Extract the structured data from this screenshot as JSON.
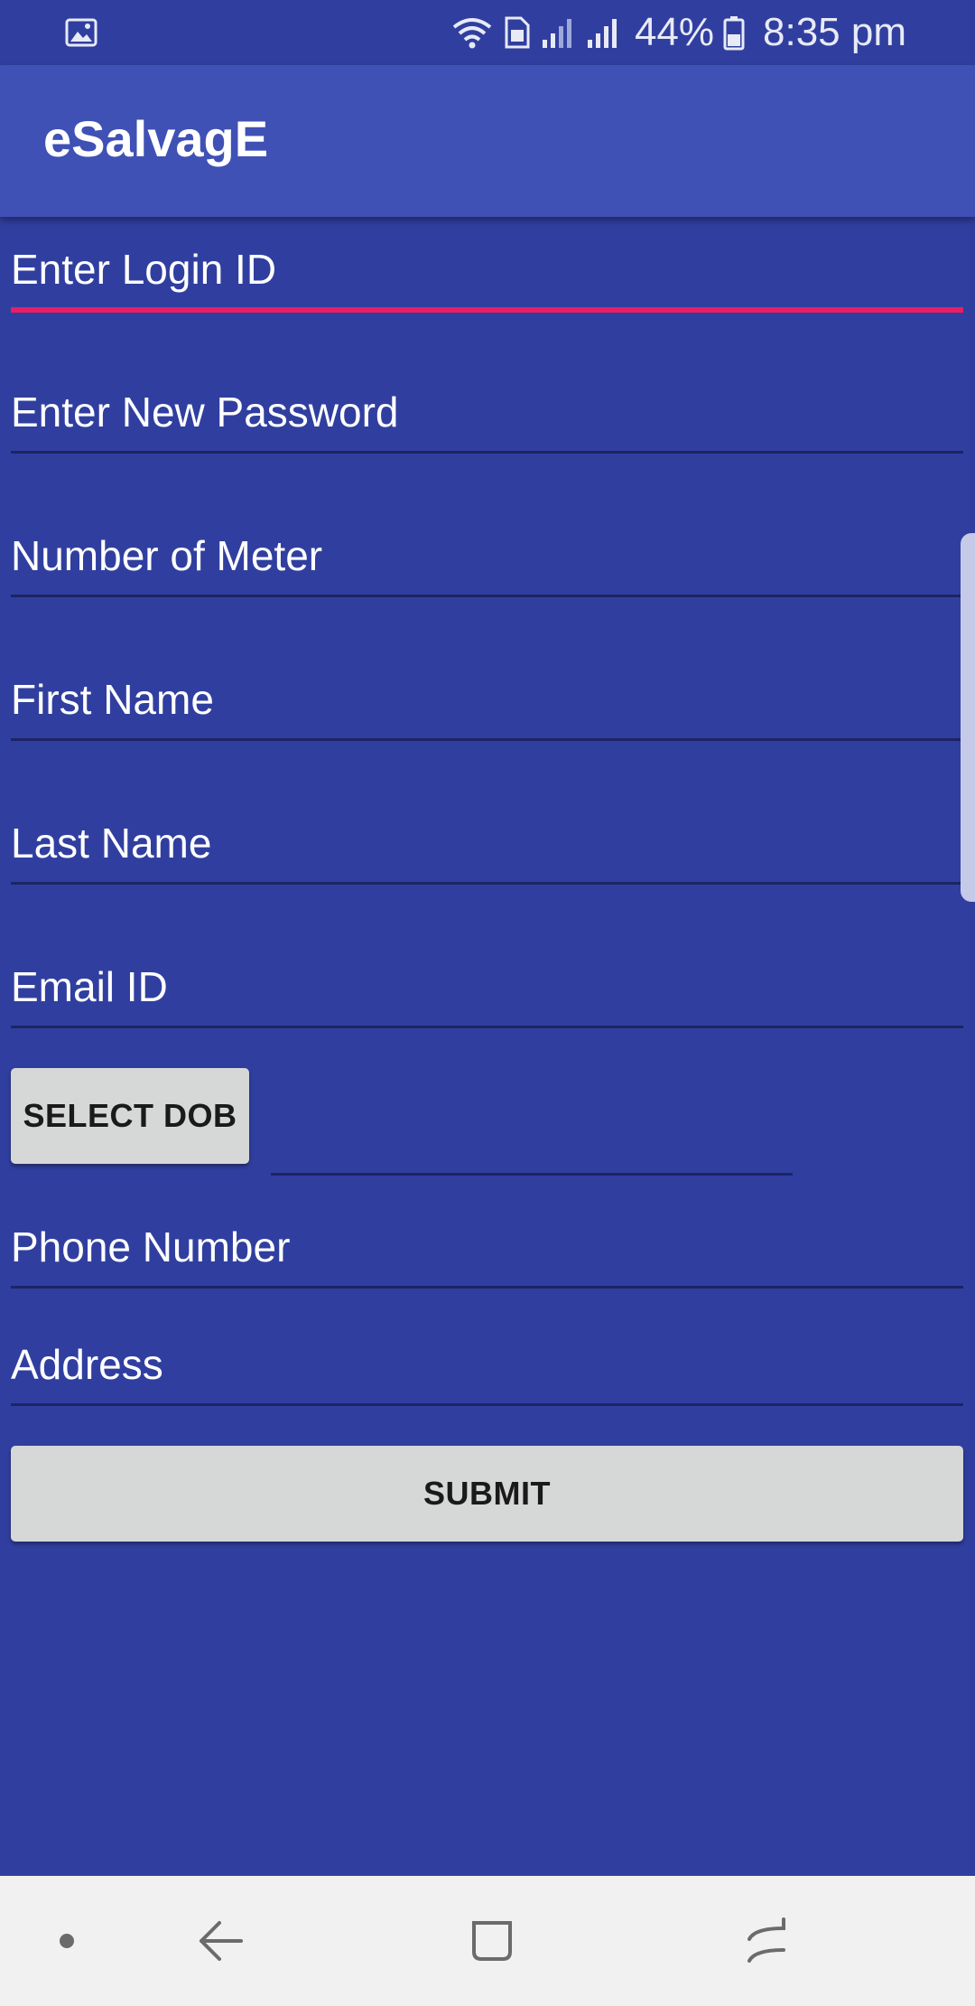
{
  "status_bar": {
    "left_icon": "image-icon",
    "icons": [
      "wifi-icon",
      "sim-icon",
      "signal-icon",
      "signal-icon",
      "battery-icon"
    ],
    "battery_percent": "44%",
    "time": "8:35 pm"
  },
  "app_bar": {
    "title": "eSalvagE"
  },
  "form": {
    "login_id": {
      "placeholder": "Enter Login ID",
      "value": ""
    },
    "new_password": {
      "placeholder": "Enter New Password",
      "value": ""
    },
    "meter_number": {
      "placeholder": "Number of Meter",
      "value": ""
    },
    "first_name": {
      "placeholder": "First Name",
      "value": ""
    },
    "last_name": {
      "placeholder": "Last Name",
      "value": ""
    },
    "email": {
      "placeholder": "Email ID",
      "value": ""
    },
    "select_dob_label": "SELECT DOB",
    "dob_value": "",
    "phone": {
      "placeholder": "Phone Number",
      "value": ""
    },
    "address": {
      "placeholder": "Address",
      "value": ""
    },
    "submit_label": "SUBMIT"
  },
  "colors": {
    "background": "#303f9f",
    "app_bar": "#3f51b5",
    "accent": "#e91e63",
    "button": "#d6d7d7",
    "nav_bar": "#f1f1f1"
  },
  "nav_bar": {
    "icons": [
      "dot-icon",
      "back-icon",
      "recents-icon",
      "menu-icon"
    ]
  }
}
